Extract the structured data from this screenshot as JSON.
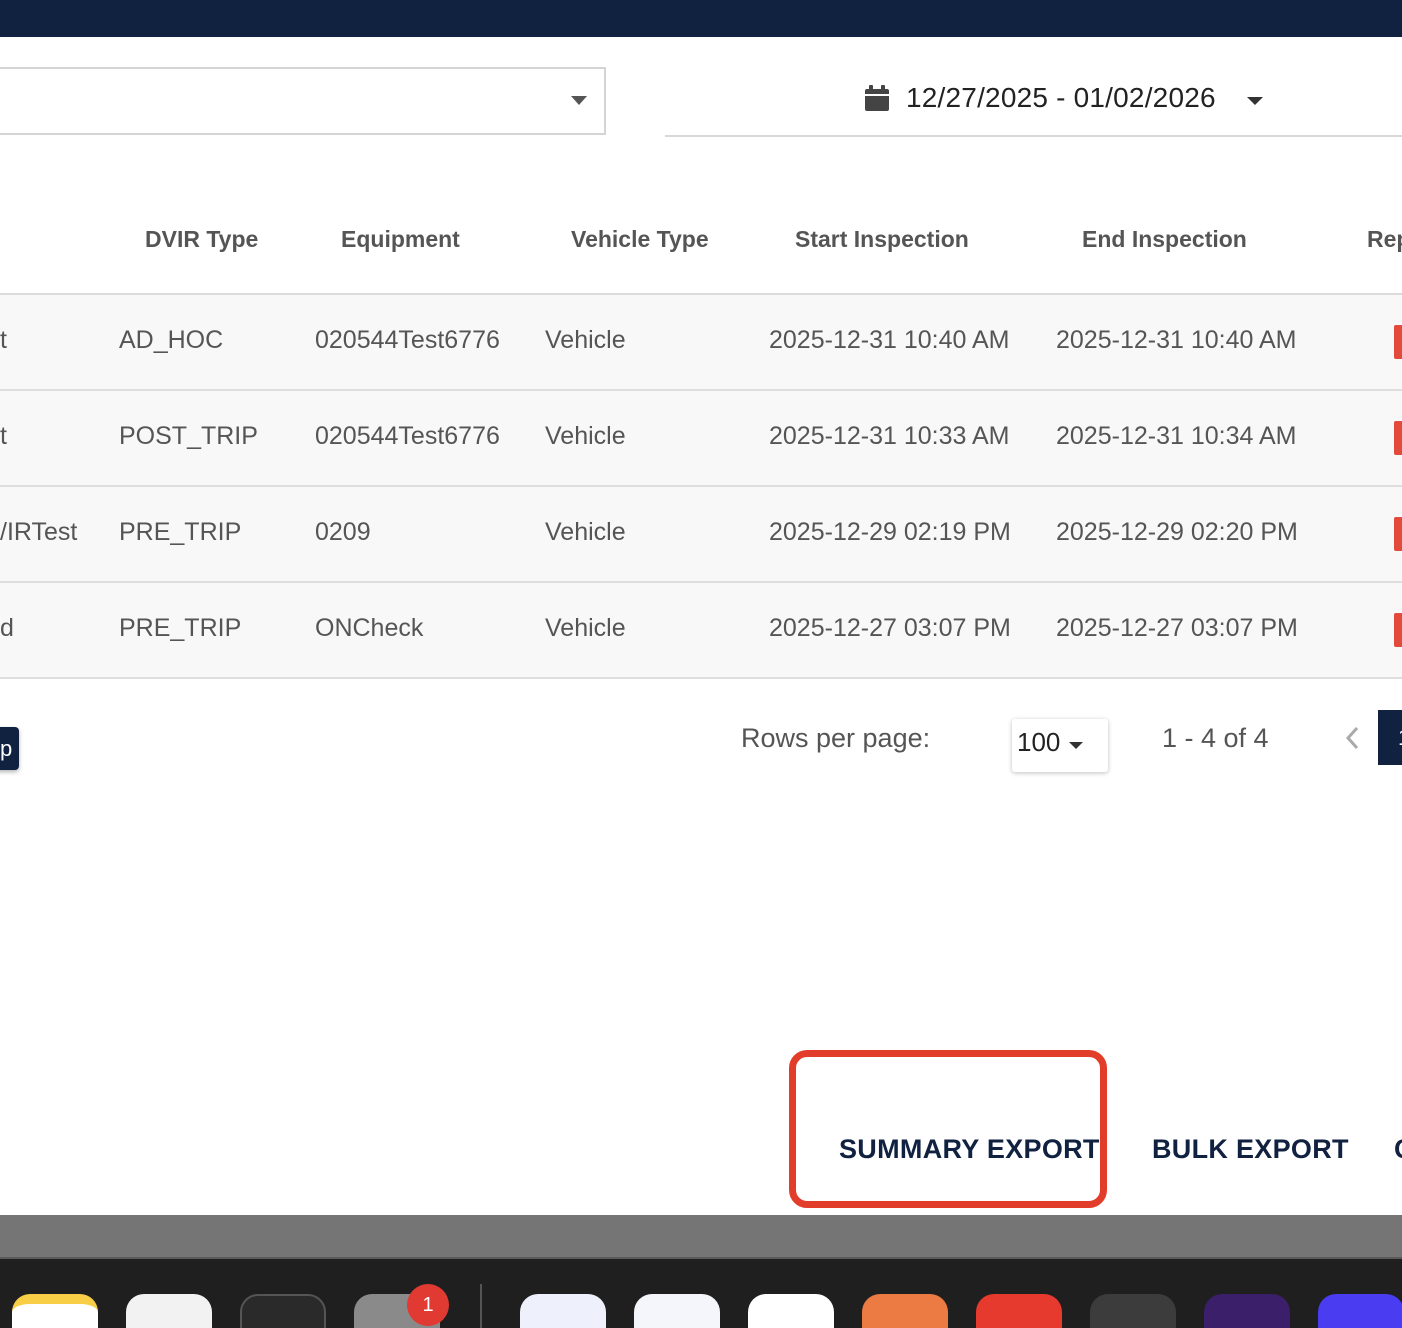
{
  "filters": {
    "date_range": "12/27/2025 - 01/02/2026"
  },
  "table": {
    "columns": [
      "DVIR Type",
      "Equipment",
      "Vehicle Type",
      "Start Inspection",
      "End Inspection",
      "Rep"
    ],
    "rows": [
      {
        "driver": "t",
        "dvir_type": "AD_HOC",
        "equipment": "020544Test6776",
        "vehicle_type": "Vehicle",
        "start": "2025-12-31 10:40 AM",
        "end": "2025-12-31 10:40 AM"
      },
      {
        "driver": "t",
        "dvir_type": "POST_TRIP",
        "equipment": "020544Test6776",
        "vehicle_type": "Vehicle",
        "start": "2025-12-31 10:33 AM",
        "end": "2025-12-31 10:34 AM"
      },
      {
        "driver": "/IRTest",
        "dvir_type": "PRE_TRIP",
        "equipment": "0209",
        "vehicle_type": "Vehicle",
        "start": "2025-12-29 02:19 PM",
        "end": "2025-12-29 02:20 PM"
      },
      {
        "driver": "d",
        "dvir_type": "PRE_TRIP",
        "equipment": "ONCheck",
        "vehicle_type": "Vehicle",
        "start": "2025-12-27 03:07 PM",
        "end": "2025-12-27 03:07 PM"
      }
    ]
  },
  "left_chip": "p",
  "pagination": {
    "rows_per_page_label": "Rows per page:",
    "rows_per_page": "100",
    "range": "1 - 4 of 4",
    "current_page": "1"
  },
  "exports": {
    "summary": "SUMMARY EXPORT",
    "bulk": "BULK EXPORT",
    "cut": "C"
  },
  "dock": {
    "badge_count": "1"
  },
  "colors": {
    "navy": "#102240",
    "highlight": "#e23d2a",
    "report_red": "#e24a3b"
  }
}
